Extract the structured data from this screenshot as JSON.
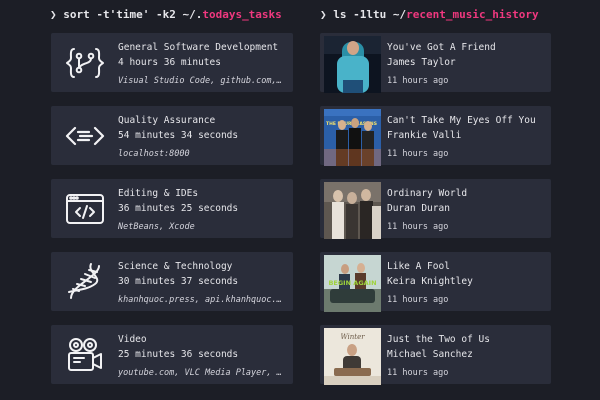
{
  "left_prompt": {
    "symbol": "❯",
    "command": "sort -t'time' -k2 ~/.",
    "path": "todays_tasks"
  },
  "right_prompt": {
    "symbol": "❯",
    "command": "ls -1ltu ~/",
    "path": "recent_music_history"
  },
  "tasks": [
    {
      "name": "General Software Development",
      "duration": "4 hours 36 minutes",
      "apps": "Visual Studio Code, github.com, it…",
      "icon": "code-branch-icon"
    },
    {
      "name": "Quality Assurance",
      "duration": "54 minutes 34 seconds",
      "apps": "localhost:8000",
      "icon": "code-arrows-icon"
    },
    {
      "name": "Editing & IDEs",
      "duration": "36 minutes 25 seconds",
      "apps": "NetBeans, Xcode",
      "icon": "code-window-icon"
    },
    {
      "name": "Science & Technology",
      "duration": "30 minutes 37 seconds",
      "apps": "khanhquoc.press, api.khanhquoc.pre…",
      "icon": "dna-icon"
    },
    {
      "name": "Video",
      "duration": "25 minutes 36 seconds",
      "apps": "youtube.com, VLC Media Player, phi…",
      "icon": "movie-camera-icon"
    }
  ],
  "music": [
    {
      "title": "You've Got A Friend",
      "artist": "James Taylor",
      "ago": "11 hours ago",
      "cover": "james-taylor-cover"
    },
    {
      "title": "Can't Take My Eyes Off You",
      "artist": "Frankie Valli",
      "ago": "11 hours ago",
      "cover": "four-seasons-cover"
    },
    {
      "title": "Ordinary World",
      "artist": "Duran Duran",
      "ago": "11 hours ago",
      "cover": "duran-duran-cover"
    },
    {
      "title": "Like A Fool",
      "artist": "Keira Knightley",
      "ago": "11 hours ago",
      "cover": "begin-again-cover"
    },
    {
      "title": "Just the Two of Us",
      "artist": "Michael Sanchez",
      "ago": "11 hours ago",
      "cover": "michael-sanchez-cover"
    }
  ],
  "cover_text": {
    "four_seasons": "THE FOUR SEASONS",
    "begin_again": "BEGIN AGAIN",
    "winter": "Winter"
  },
  "colors": {
    "background": "#1c1e26",
    "card": "#2a2d3a",
    "accent": "#f0387f",
    "text": "#e6e6ea"
  }
}
